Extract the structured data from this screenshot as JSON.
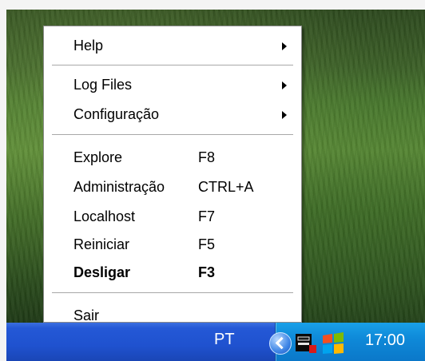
{
  "menu": {
    "groups": [
      {
        "items": [
          {
            "label": "Help",
            "submenu": true
          }
        ]
      },
      {
        "items": [
          {
            "label": "Log Files",
            "submenu": true
          },
          {
            "label": "Configuração",
            "submenu": true
          }
        ]
      },
      {
        "items": [
          {
            "label": "Explore",
            "shortcut": "F8"
          },
          {
            "label": "Administração",
            "shortcut": "CTRL+A"
          },
          {
            "label": "Localhost",
            "shortcut": "F7"
          },
          {
            "label": "Reiniciar",
            "shortcut": "F5"
          },
          {
            "label": "Desligar",
            "shortcut": "F3",
            "bold": true
          }
        ]
      },
      {
        "items": [
          {
            "label": "Sair"
          }
        ]
      }
    ]
  },
  "taskbar": {
    "language": "PT",
    "clock": "17:00",
    "icons": [
      "show-hidden-icons-chevron-icon",
      "server-app-tray-icon",
      "windows-flag-icon"
    ],
    "colors": {
      "taskbar": "#2458d6",
      "tray": "#0f8ad9"
    }
  }
}
